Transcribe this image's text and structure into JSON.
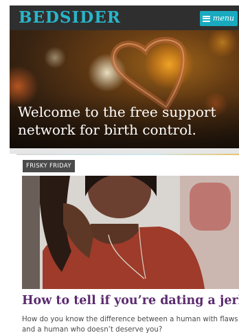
{
  "header": {
    "logo_text": "BEDSIDER",
    "menu_label": "menu",
    "brand_color": "#28b6c9"
  },
  "hero": {
    "headline": "Welcome to the free support network for birth control."
  },
  "article": {
    "category": "FRISKY FRIDAY",
    "title": "How to tell if you’re dating a jerk",
    "excerpt": "How do you know the difference between a human with flaws and a human who doesn’t deserve you?"
  }
}
